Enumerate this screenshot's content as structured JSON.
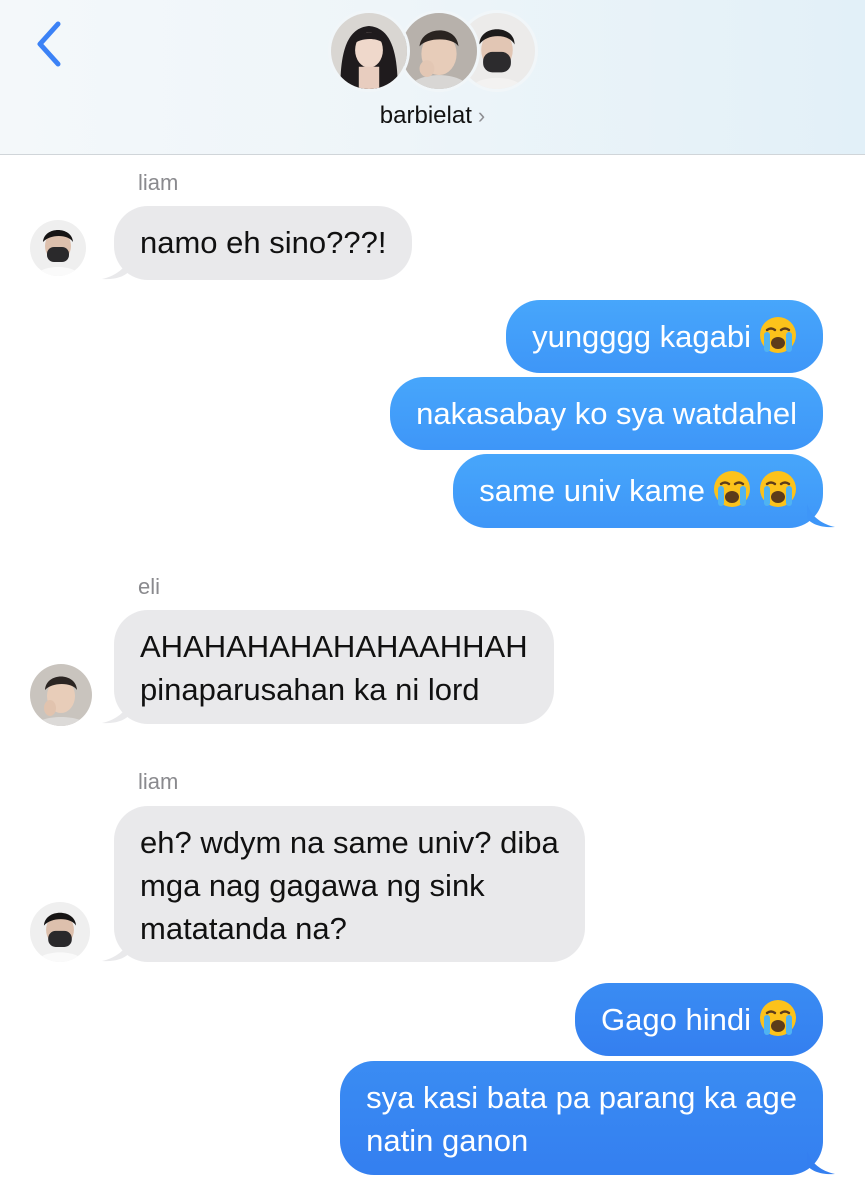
{
  "header": {
    "group_name": "barbielat",
    "chevron": "›",
    "back_icon": "chevron-left-icon",
    "accent": "#3b82f6"
  },
  "colors": {
    "incoming_bubble": "#e9e9eb",
    "outgoing_bubble": "#3e96f8",
    "sender_label": "#8a8a8e"
  },
  "messages": [
    {
      "sender": "liam",
      "direction": "in",
      "text": "namo eh sino???!"
    },
    {
      "direction": "out",
      "text": "yungggg kagabi",
      "emoji": "loudly-crying-face"
    },
    {
      "direction": "out",
      "text": "nakasabay ko sya watdahel"
    },
    {
      "direction": "out",
      "text": "same univ kame",
      "emoji": "loudly-crying-face"
    },
    {
      "sender": "eli",
      "direction": "in",
      "lines": [
        "AHAHAHAHAHAHAAHHAH",
        "pinaparusahan ka ni lord"
      ]
    },
    {
      "sender": "liam",
      "direction": "in",
      "lines": [
        "eh? wdym na same univ? diba",
        "mga nag gagawa ng sink",
        "matatanda na?"
      ]
    },
    {
      "direction": "out",
      "text": "Gago hindi",
      "emoji": "loudly-crying-face"
    },
    {
      "direction": "out",
      "lines": [
        "sya kasi bata pa parang ka age",
        "natin ganon"
      ]
    }
  ]
}
